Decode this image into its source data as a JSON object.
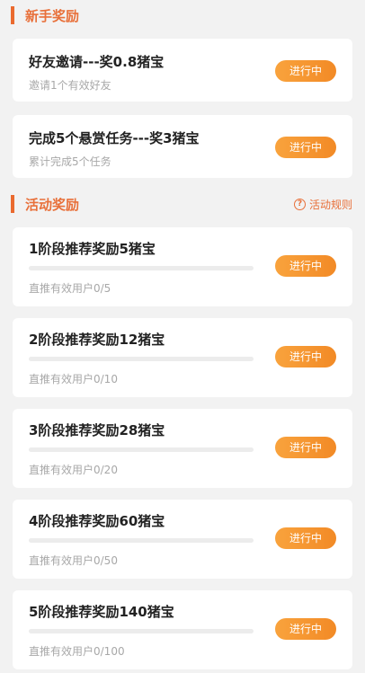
{
  "newbie_section": {
    "title": "新手奖励",
    "cards": [
      {
        "title": "好友邀请---奖0.8猪宝",
        "subtitle": "邀请1个有效好友",
        "status": "进行中"
      },
      {
        "title": "完成5个悬赏任务---奖3猪宝",
        "subtitle": "累计完成5个任务",
        "status": "进行中"
      }
    ]
  },
  "activity_section": {
    "title": "活动奖励",
    "rules_label": "活动规则",
    "rules_icon": "question-circle-icon",
    "cards": [
      {
        "title": "1阶段推荐奖励5猪宝",
        "progress_text": "直推有效用户0/5",
        "progress_fraction": 0,
        "status": "进行中"
      },
      {
        "title": "2阶段推荐奖励12猪宝",
        "progress_text": "直推有效用户0/10",
        "progress_fraction": 0,
        "status": "进行中"
      },
      {
        "title": "3阶段推荐奖励28猪宝",
        "progress_text": "直推有效用户0/20",
        "progress_fraction": 0,
        "status": "进行中"
      },
      {
        "title": "4阶段推荐奖励60猪宝",
        "progress_text": "直推有效用户0/50",
        "progress_fraction": 0,
        "status": "进行中"
      },
      {
        "title": "5阶段推荐奖励140猪宝",
        "progress_text": "直推有效用户0/100",
        "progress_fraction": 0,
        "status": "进行中"
      }
    ]
  },
  "colors": {
    "accent": "#ea6a2f",
    "button": "#f59a32",
    "background": "#f2f2f2"
  }
}
